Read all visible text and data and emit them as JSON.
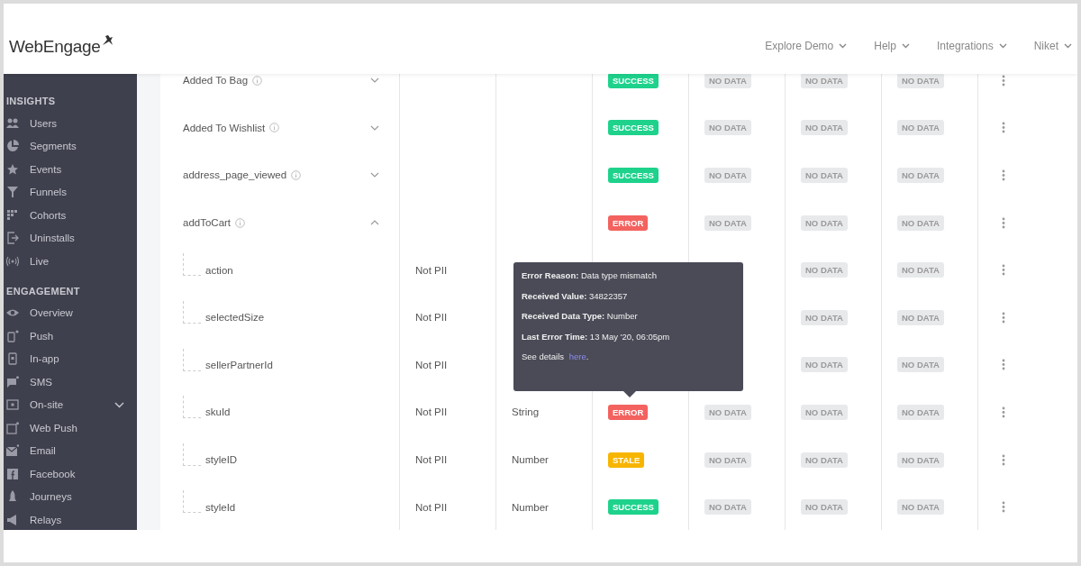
{
  "header": {
    "logo": "WebEngage",
    "nav": [
      {
        "label": "Explore Demo"
      },
      {
        "label": "Help"
      },
      {
        "label": "Integrations"
      },
      {
        "label": "Niket"
      }
    ]
  },
  "sidebar": {
    "sections": [
      {
        "title": "INSIGHTS",
        "items": [
          {
            "label": "Users",
            "kind": "users"
          },
          {
            "label": "Segments",
            "kind": "pie"
          },
          {
            "label": "Events",
            "kind": "star"
          },
          {
            "label": "Funnels",
            "kind": "funnel"
          },
          {
            "label": "Cohorts",
            "kind": "grid"
          },
          {
            "label": "Uninstalls",
            "kind": "exit"
          },
          {
            "label": "Live",
            "kind": "live"
          }
        ]
      },
      {
        "title": "ENGAGEMENT",
        "items": [
          {
            "label": "Overview",
            "kind": "eye"
          },
          {
            "label": "Push",
            "kind": "phone"
          },
          {
            "label": "In-app",
            "kind": "inapp"
          },
          {
            "label": "SMS",
            "kind": "chat"
          },
          {
            "label": "On-site",
            "kind": "window",
            "expandable": true
          },
          {
            "label": "Web Push",
            "kind": "browser"
          },
          {
            "label": "Email",
            "kind": "mail"
          },
          {
            "label": "Facebook",
            "kind": "facebook"
          },
          {
            "label": "Journeys",
            "kind": "rocket"
          },
          {
            "label": "Relays",
            "kind": "megaphone"
          }
        ]
      }
    ]
  },
  "events": [
    {
      "name": "Added To Bag",
      "expanded": false,
      "status": {
        "kind": "success",
        "label": "SUCCESS"
      },
      "metrics": [
        "NO DATA",
        "NO DATA",
        "NO DATA"
      ]
    },
    {
      "name": "Added To Wishlist",
      "expanded": false,
      "status": {
        "kind": "success",
        "label": "SUCCESS"
      },
      "metrics": [
        "NO DATA",
        "NO DATA",
        "NO DATA"
      ]
    },
    {
      "name": "address_page_viewed",
      "expanded": false,
      "status": {
        "kind": "success",
        "label": "SUCCESS"
      },
      "metrics": [
        "NO DATA",
        "NO DATA",
        "NO DATA"
      ]
    },
    {
      "name": "addToCart",
      "expanded": true,
      "status": {
        "kind": "error",
        "label": "ERROR"
      },
      "metrics": [
        "NO DATA",
        "NO DATA",
        "NO DATA"
      ],
      "children": [
        {
          "name": "action",
          "pii": "Not PII",
          "metrics": [
            "NO DATA",
            "NO DATA"
          ]
        },
        {
          "name": "selectedSize",
          "pii": "Not PII",
          "metrics": [
            "NO DATA",
            "NO DATA"
          ]
        },
        {
          "name": "sellerPartnerId",
          "pii": "Not PII",
          "metrics": [
            "NO DATA",
            "NO DATA"
          ]
        },
        {
          "name": "skuId",
          "pii": "Not PII",
          "type": "String",
          "status": {
            "kind": "error",
            "label": "ERROR"
          },
          "metrics": [
            "NO DATA",
            "NO DATA",
            "NO DATA"
          ]
        },
        {
          "name": "styleID",
          "pii": "Not PII",
          "type": "Number",
          "status": {
            "kind": "stale",
            "label": "STALE"
          },
          "metrics": [
            "NO DATA",
            "NO DATA",
            "NO DATA"
          ]
        },
        {
          "name": "styleId",
          "pii": "Not PII",
          "type": "Number",
          "status": {
            "kind": "success",
            "label": "SUCCESS"
          },
          "metrics": [
            "NO DATA",
            "NO DATA",
            "NO DATA"
          ]
        }
      ]
    }
  ],
  "tooltip": {
    "lines": [
      "**Error Reason:** Data type mismatch",
      "**Received Value:** 34822357",
      "**Received Data Type:** Number",
      "**Last Error Time:** 13 May '20, 06:05pm"
    ],
    "details": {
      "text": "See details",
      "link": "here",
      "after": "."
    }
  }
}
